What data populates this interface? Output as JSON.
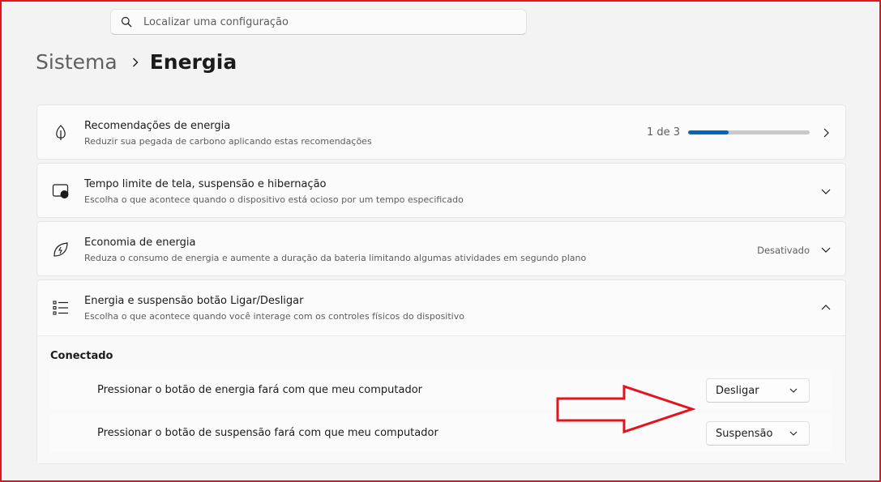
{
  "search": {
    "placeholder": "Localizar uma configuração"
  },
  "breadcrumb": {
    "parent": "Sistema",
    "current": "Energia"
  },
  "cards": [
    {
      "title": "Recomendações de energia",
      "description": "Reduzir sua pegada de carbono aplicando estas recomendações",
      "icon": "leaf-icon",
      "counter": "1 de 3",
      "progress": 0.33
    },
    {
      "title": "Tempo limite de tela, suspensão e hibernação",
      "description": "Escolha o que acontece quando o dispositivo está ocioso por um tempo especificado",
      "icon": "screen-sleep-icon"
    },
    {
      "title": "Economia de energia",
      "description": "Reduza o consumo de energia e aumente a duração da bateria limitando algumas atividades em segundo plano",
      "icon": "energy-saver-leaf-icon",
      "status": "Desativado"
    },
    {
      "title": "Energia e suspensão botão Ligar/Desligar",
      "description": "Escolha o que acontece quando você interage com os controles físicos do dispositivo",
      "icon": "list-icon",
      "section": "Conectado",
      "settings": [
        {
          "label": "Pressionar o botão de energia fará com que meu computador",
          "value": "Desligar"
        },
        {
          "label": "Pressionar o botão de suspensão fará com que meu computador",
          "value": "Suspensão"
        }
      ]
    }
  ],
  "colors": {
    "accent": "#0067c0",
    "annotation": "#e3141d"
  }
}
